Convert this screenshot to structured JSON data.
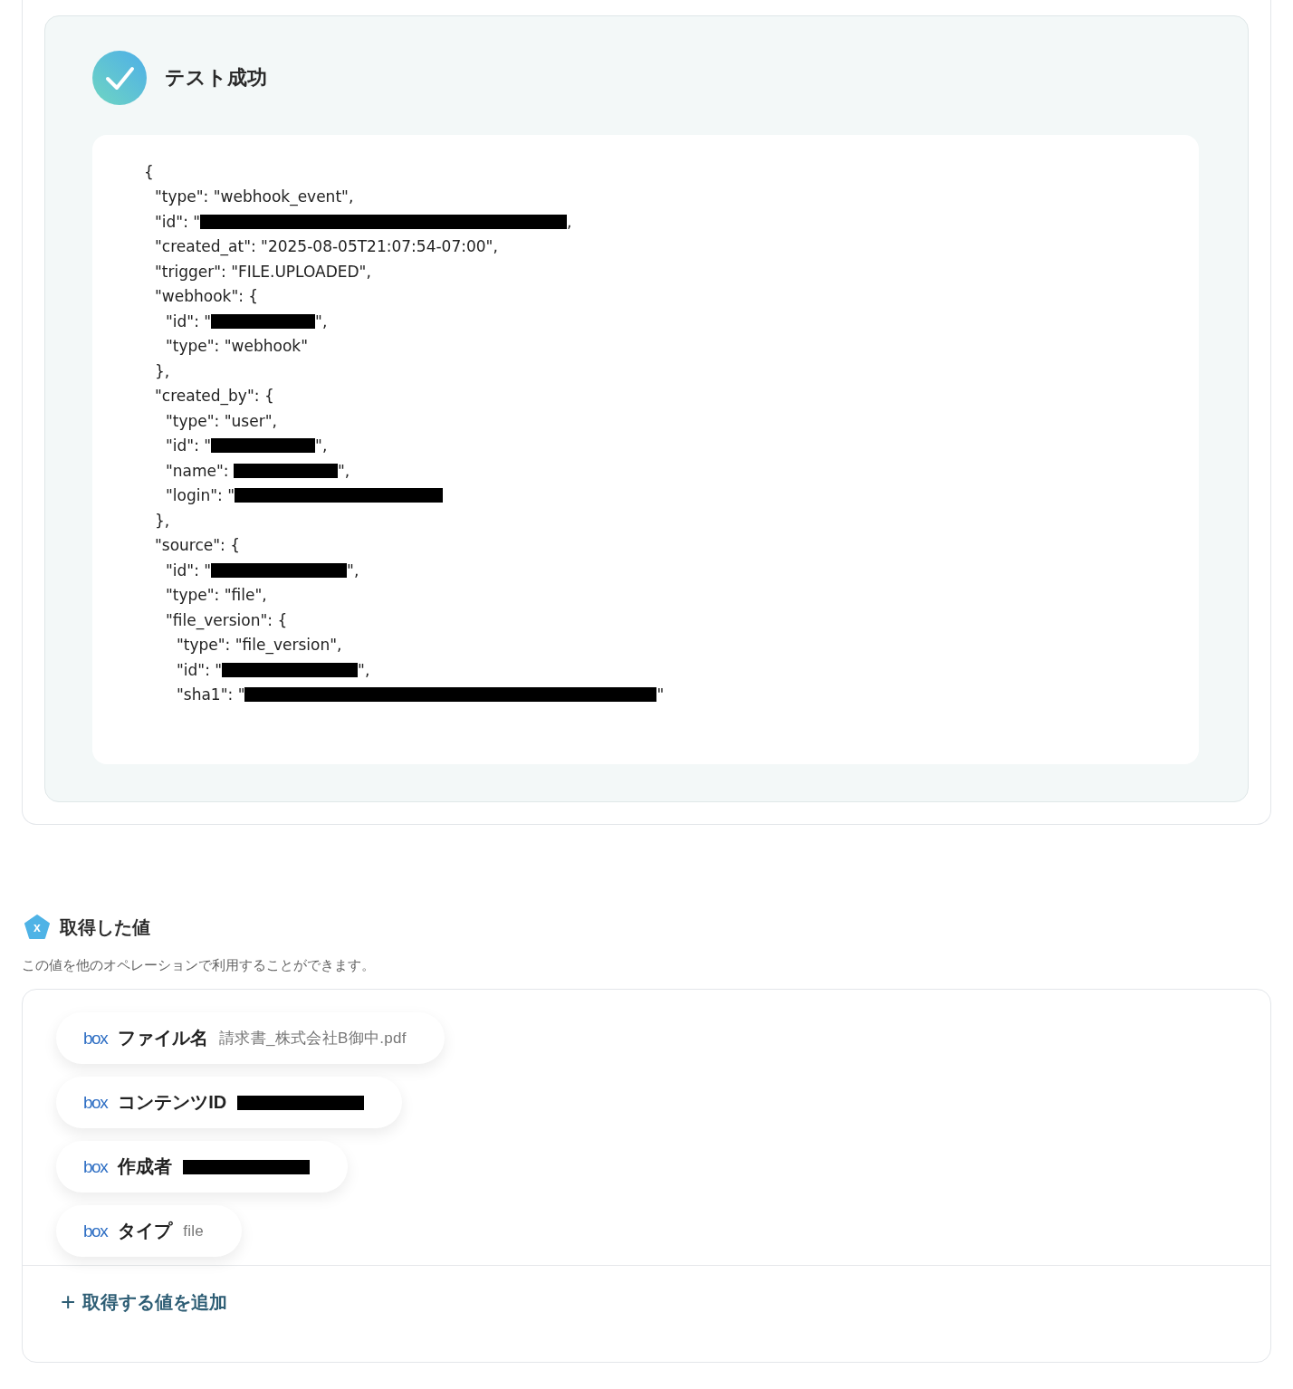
{
  "test_result": {
    "title": "テスト成功",
    "code": [
      {
        "kind": "plain",
        "text": "{",
        "children": [
          {
            "kind": "plain",
            "text": "\"type\": \"webhook_event\","
          },
          {
            "kind": "masked_wide",
            "text": "\"id\": \"",
            "after": ","
          },
          {
            "kind": "plain",
            "text": "\"created_at\": \"2025-08-05T21:07:54-07:00\","
          },
          {
            "kind": "plain",
            "text": "\"trigger\": \"FILE.UPLOADED\","
          },
          {
            "kind": "plain",
            "text": "\"webhook\": {",
            "children": [
              {
                "kind": "masked_short",
                "text": "\"id\": \"",
                "after": "\","
              },
              {
                "kind": "plain",
                "text": "\"type\": \"webhook\""
              }
            ]
          },
          {
            "kind": "plain",
            "text": "},"
          },
          {
            "kind": "plain",
            "text": "\"created_by\": {",
            "children": [
              {
                "kind": "plain",
                "text": "\"type\": \"user\","
              },
              {
                "kind": "masked_short",
                "text": "\"id\": \"",
                "after": "\","
              },
              {
                "kind": "masked_short",
                "text": "\"name\": ",
                "after": "\","
              },
              {
                "kind": "masked_long",
                "text": "\"login\": \""
              }
            ]
          },
          {
            "kind": "plain",
            "text": "},"
          },
          {
            "kind": "plain",
            "text": "\"source\": {",
            "children": [
              {
                "kind": "masked_medium",
                "text": "\"id\": \"",
                "after": "\","
              },
              {
                "kind": "plain",
                "text": "\"type\": \"file\","
              },
              {
                "kind": "plain",
                "text": "\"file_version\": {",
                "children": [
                  {
                    "kind": "plain",
                    "text": "\"type\": \"file_version\","
                  },
                  {
                    "kind": "masked_medium",
                    "text": "\"id\": \"",
                    "after": "\","
                  },
                  {
                    "kind": "masked_full",
                    "text": "\"sha1\": \"",
                    "after": "\""
                  }
                ]
              }
            ]
          }
        ]
      }
    ]
  },
  "values": {
    "title": "取得した値",
    "icon_glyph": "x",
    "description": "この値を他のオペレーションで利用することができます。",
    "items": [
      {
        "kind": "plain",
        "source": "box",
        "label": "ファイル名",
        "value": "請求書_株式会社B御中.pdf"
      },
      {
        "kind": "masked_medium",
        "source": "box",
        "label": "コンテンツID"
      },
      {
        "kind": "masked_medium",
        "source": "box",
        "label": "作成者"
      },
      {
        "kind": "plain",
        "source": "box",
        "label": "タイプ",
        "value": "file"
      }
    ],
    "add_button": {
      "icon": "+",
      "label": "取得する値を追加"
    }
  }
}
